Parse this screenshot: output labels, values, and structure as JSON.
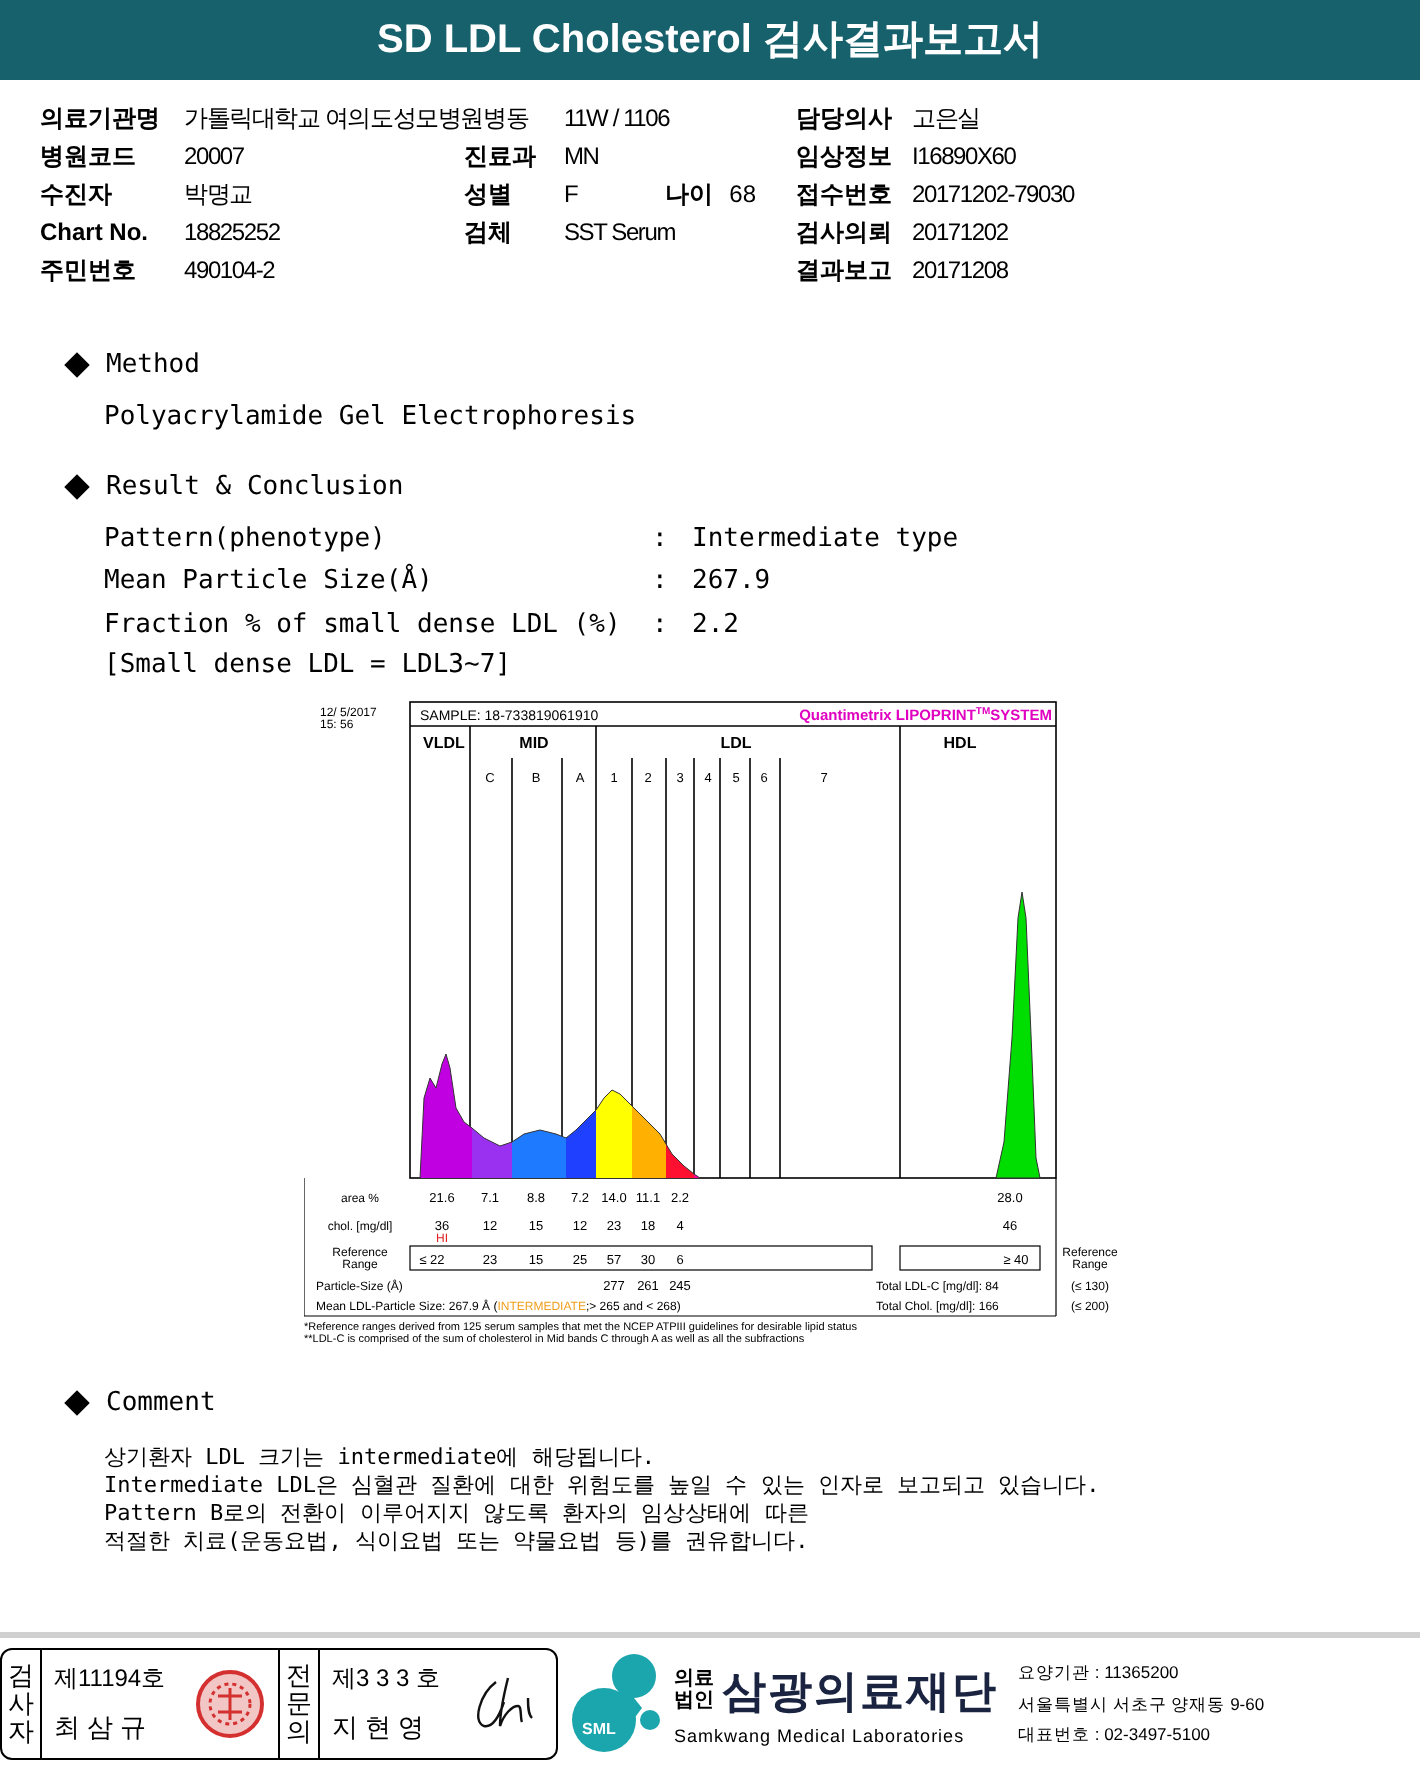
{
  "title": "SD LDL Cholesterol 검사결과보고서",
  "info_rows": [
    {
      "left": {
        "label": "의료기관명",
        "value": "가톨릭대학교 여의도성모병원병동"
      },
      "middle": {
        "value": "11W / 1106"
      },
      "right": {
        "label": "담당의사",
        "value": "고은실"
      }
    },
    {
      "left": {
        "label": "병원코드",
        "value": "20007"
      },
      "middle": {
        "label": "진료과",
        "value": "MN"
      },
      "right": {
        "label": "임상정보",
        "value": "I16890X60"
      }
    },
    {
      "left": {
        "label": "수진자",
        "value": "박명교"
      },
      "middle": {
        "label": "성별",
        "value": "F",
        "extra_label": "나이",
        "extra_value": "68"
      },
      "right": {
        "label": "접수번호",
        "value": "20171202-79030"
      }
    },
    {
      "left": {
        "label": "Chart No.",
        "value": "18825252"
      },
      "middle": {
        "label": "검체",
        "value": "SST Serum"
      },
      "right": {
        "label": "검사의뢰",
        "value": "20171202"
      }
    },
    {
      "left": {
        "label": "주민번호",
        "value": "490104-2"
      },
      "right": {
        "label": "결과보고",
        "value": "20171208"
      }
    }
  ],
  "method": {
    "heading": "Method",
    "text": "Polyacrylamide Gel Electrophoresis"
  },
  "result": {
    "heading": "Result & Conclusion",
    "items": [
      {
        "label": "Pattern(phenotype)",
        "separator": ":",
        "value": "Intermediate type"
      },
      {
        "label": "Mean Particle Size(Å)",
        "separator": ":",
        "value": "267.9"
      },
      {
        "label": "Fraction % of small dense LDL (%)",
        "separator": ":",
        "value": "2.2"
      }
    ],
    "note": "[Small dense LDL = LDL3~7]"
  },
  "electrophoresis": {
    "date_lines": [
      "12/ 5/2017",
      "15: 56"
    ],
    "sample": "SAMPLE:  18-733819061910",
    "brand": "Quantimetrix LIPOPRINT$^{TM}$SYSTEM",
    "groups": [
      "VLDL",
      "MID",
      "LDL",
      "HDL"
    ],
    "bands": [
      "C",
      "B",
      "A",
      "1",
      "2",
      "3",
      "4",
      "5",
      "6",
      "7"
    ],
    "area_row": {
      "label": "area %",
      "values": [
        "21.6",
        "7.1",
        "8.8",
        "7.2",
        "14.0",
        "11.1",
        "2.2"
      ],
      "hdl": "28.0"
    },
    "chol_row": {
      "label": "chol. [mg/dl]",
      "values": [
        "36",
        "12",
        "15",
        "12",
        "23",
        "18",
        "4"
      ],
      "flag": "HI",
      "hdl": "46"
    },
    "reference_row": {
      "label_lines": [
        "Reference",
        "Range"
      ],
      "values": [
        "≤ 22",
        "23",
        "15",
        "25",
        "57",
        "30",
        "6"
      ],
      "hdl": "≥ 40",
      "right_label_lines": [
        "Reference",
        "Range"
      ]
    },
    "particle_row": {
      "label": "Particle-Size (Å)",
      "values": [
        "277",
        "261",
        "245"
      ],
      "right_label": "Total LDL-C [mg/dl]:  84",
      "right_range": "(≤ 130)"
    },
    "mean_row": {
      "text": "Mean LDL-Particle Size:  267.9 Å  (",
      "highlight": "INTERMEDIATE",
      "rest": ";> 265 and < 268)",
      "right_label": "Total Chol. [mg/dl]:  166",
      "right_range": "(≤ 200)"
    },
    "footnotes": [
      "*Reference ranges derived from 125 serum samples that met the NCEP ATPIII guidelines for desirable lipid status",
      "**LDL-C is comprised of the sum of cholesterol in Mid bands C through A as well as all the subfractions"
    ]
  },
  "comment": {
    "heading": "Comment",
    "lines": [
      "상기환자 LDL 크기는 intermediate에 해당됩니다.",
      "Intermediate LDL은 심혈관 질환에 대한 위험도를 높일 수 있는 인자로 보고되고 있습니다.",
      "Pattern B로의 전환이 이루어지지 않도록 환자의 임상상태에 따른",
      "적절한 치료(운동요법, 식이요법 또는 약물요법 등)를 권유합니다."
    ]
  },
  "footer": {
    "signers": [
      {
        "role": "검사자",
        "number": "제11194호",
        "name": "최 삼 규",
        "kind": "stamp"
      },
      {
        "role": "전문의",
        "number": "제3 3 3 호",
        "name": "지 현 영",
        "kind": "signature"
      }
    ],
    "logo_text": "SML",
    "org_prefix": [
      "의료",
      "법인"
    ],
    "org_name": "삼광의료재단",
    "org_english": "Samkwang Medical Laboratories",
    "contact": [
      "요양기관 : 11365200",
      "서울특별시 서초구 양재동 9-60",
      "대표번호 : 02-3497-5100"
    ]
  }
}
